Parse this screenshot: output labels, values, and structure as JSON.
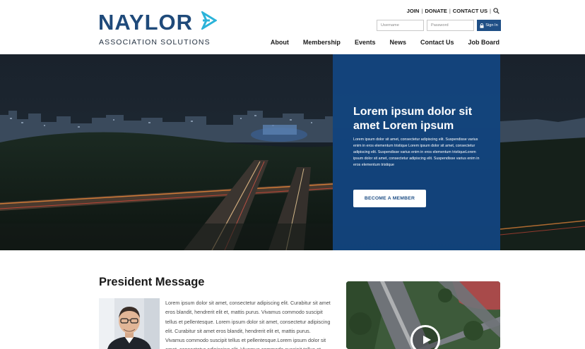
{
  "brand": {
    "name": "NAYLOR",
    "tagline": "ASSOCIATION SOLUTIONS",
    "primary_color": "#1f4a7a",
    "accent_color": "#2bb3d9"
  },
  "utility_links": [
    {
      "label": "JOIN"
    },
    {
      "label": "DONATE"
    },
    {
      "label": "CONTACT US"
    }
  ],
  "utility_icon": "search-icon",
  "login": {
    "username_placeholder": "Username",
    "password_placeholder": "Password",
    "signin_label": "Sign In",
    "signin_icon": "lock-icon"
  },
  "nav": [
    {
      "label": "About"
    },
    {
      "label": "Membership"
    },
    {
      "label": "Events"
    },
    {
      "label": "News"
    },
    {
      "label": "Contact Us"
    },
    {
      "label": "Job Board"
    }
  ],
  "hero": {
    "title": "Lorem ipsum dolor sit amet Lorem ipsum",
    "body": "Lorem ipsum dolor sit amet, consectetur adipiscing elit. Suspendisse varius enim in eros elementum tristique Lorem ipsum dolor sit amet, consectetur adipiscing elit. Suspendisse varius enim in eros elementum tristiqueLorem ipsum dolor sit amet, consectetur adipiscing elit. Suspendisse varius enim in eros elementum tristique",
    "button_label": "BECOME A MEMBER",
    "panel_color": "#124682"
  },
  "president": {
    "title": "President Message",
    "text": "Lorem ipsum dolor sit amet, consectetur adipiscing elit. Curabitur sit amet eros blandit, hendrerit elit et, mattis purus. Vivamus commodo suscipit tellus et pellentesque. Lorem ipsum dolor sit amet, consectetur adipiscing elit. Curabitur sit amet eros blandit, hendrerit elit et, mattis purus. Vivamus commodo suscipit tellus et pellentesque.Lorem ipsum dolor sit amet, consectetur adipiscing elit. Vivamus commodo suscipit tellus et"
  },
  "video": {
    "icon": "play-icon"
  }
}
